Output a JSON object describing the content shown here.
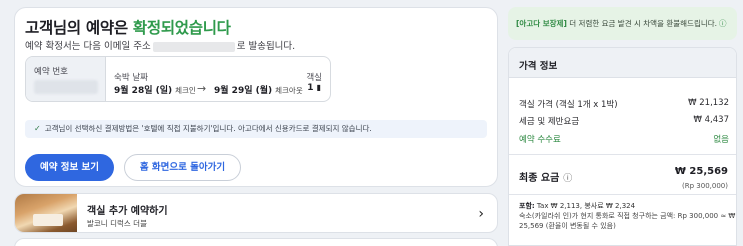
{
  "confirmation": {
    "title_prefix": "고객님의 예약은 ",
    "title_accent": "확정되었습니다",
    "subtitle_before": "예약 확정서는 다음 이메일 주소",
    "subtitle_after": "로 발송됩니다."
  },
  "booking": {
    "number_label": "예약 번호",
    "dates_label": "숙박 날짜",
    "checkin_date": "9월 28일 (일)",
    "checkin_sub": "체크인",
    "checkout_date": "9월 29일 (월)",
    "checkout_sub": "체크아웃",
    "rooms_label": "객실",
    "rooms_value": "1"
  },
  "payment_note": "고객님이 선택하신 결제방법은 '호텔에 직접 지불하기'입니다. 아고다에서 신용카드로 결제되지 않습니다.",
  "buttons": {
    "view_booking": "예약 정보 보기",
    "go_home": "홈 화면으로 돌아가기"
  },
  "add_room": {
    "title": "객실 추가 예약하기",
    "subtitle": "발코니 디럭스 더블"
  },
  "guarantee": {
    "strong": "[아고다 보장제]",
    "text": " 더 저렴한 요금 발견 시 차액을 환불해드립니다."
  },
  "price": {
    "header": "가격 정보",
    "rows": [
      {
        "label": "객실 가격 (객실 1개 x 1박)",
        "value": "₩ 21,132"
      },
      {
        "label": "세금 및 제반요금",
        "value": "₩ 4,437"
      },
      {
        "label": "예약 수수료",
        "value": "없음"
      }
    ],
    "total_label": "최종 요금",
    "total_value": "₩ 25,569",
    "total_sub": "(Rp 300,000)",
    "included_label": "포함:",
    "included_text": " Tax ₩ 2,113, 봉사료 ₩ 2,324",
    "note_line1": "숙소(카일라쉬 인)가 현지 통화로 직접 청구하는 금액: Rp 300,000 ≈ ₩",
    "note_line2": "25,569 (환율이 변동될 수 있음)"
  },
  "colors": {
    "accent_green": "#2f9a4c",
    "primary_blue": "#2f67e0",
    "guarantee_bg": "#e6f3e6"
  }
}
